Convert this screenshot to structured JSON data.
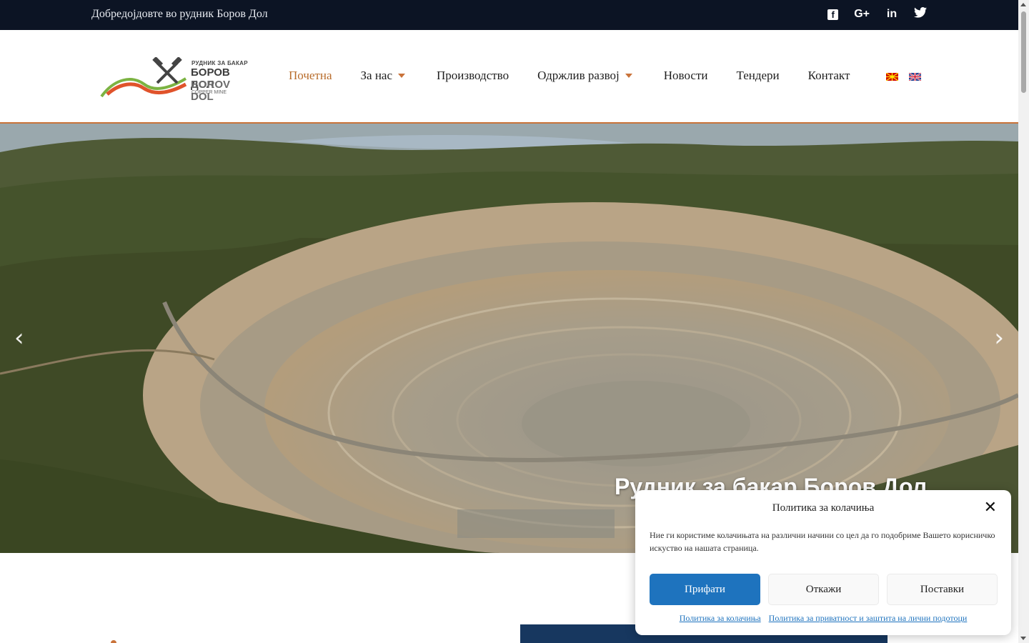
{
  "topbar": {
    "welcome": "Добредојдовте во рудник Боров Дол",
    "social": [
      {
        "icon": "facebook-icon",
        "glyph": "f"
      },
      {
        "icon": "google-plus-icon",
        "glyph": "G+"
      },
      {
        "icon": "linkedin-icon",
        "glyph": "in"
      },
      {
        "icon": "twitter-icon",
        "glyph": "🐦"
      }
    ]
  },
  "logo": {
    "line1": "РУДНИК ЗА БАКАР",
    "line2": "БОРОВ ДОЛ",
    "line3": "BOROV DOL",
    "line4": "COPPER MINE"
  },
  "nav": {
    "items": [
      {
        "label": "Почетна",
        "active": true,
        "dropdown": false
      },
      {
        "label": "За нас",
        "active": false,
        "dropdown": true
      },
      {
        "label": "Производство",
        "active": false,
        "dropdown": false
      },
      {
        "label": "Одржлив развој",
        "active": false,
        "dropdown": true
      },
      {
        "label": "Новости",
        "active": false,
        "dropdown": false
      },
      {
        "label": "Тендери",
        "active": false,
        "dropdown": false
      },
      {
        "label": "Контакт",
        "active": false,
        "dropdown": false
      }
    ],
    "languages": [
      "mk-flag-icon",
      "uk-flag-icon"
    ]
  },
  "hero": {
    "caption": "Рудник за бакар Боров Дол",
    "prev_glyph": "‹",
    "next_glyph": "›"
  },
  "cookie": {
    "title": "Политика за колачиња",
    "close_glyph": "✕",
    "text": "Ние ги користиме колачињата на различни начини со цел да го подобриме Вашето корисничко искуство на нашата страница.",
    "accept": "Прифати",
    "deny": "Откажи",
    "settings": "Поставки",
    "link_cookies": "Политика за колачиња",
    "link_privacy": "Политика за приватност и заштита на лични подотоци"
  },
  "colors": {
    "topbar_bg": "#0c1424",
    "accent": "#c9733a",
    "primary_button": "#1e73be",
    "blue_block": "#17375f"
  }
}
